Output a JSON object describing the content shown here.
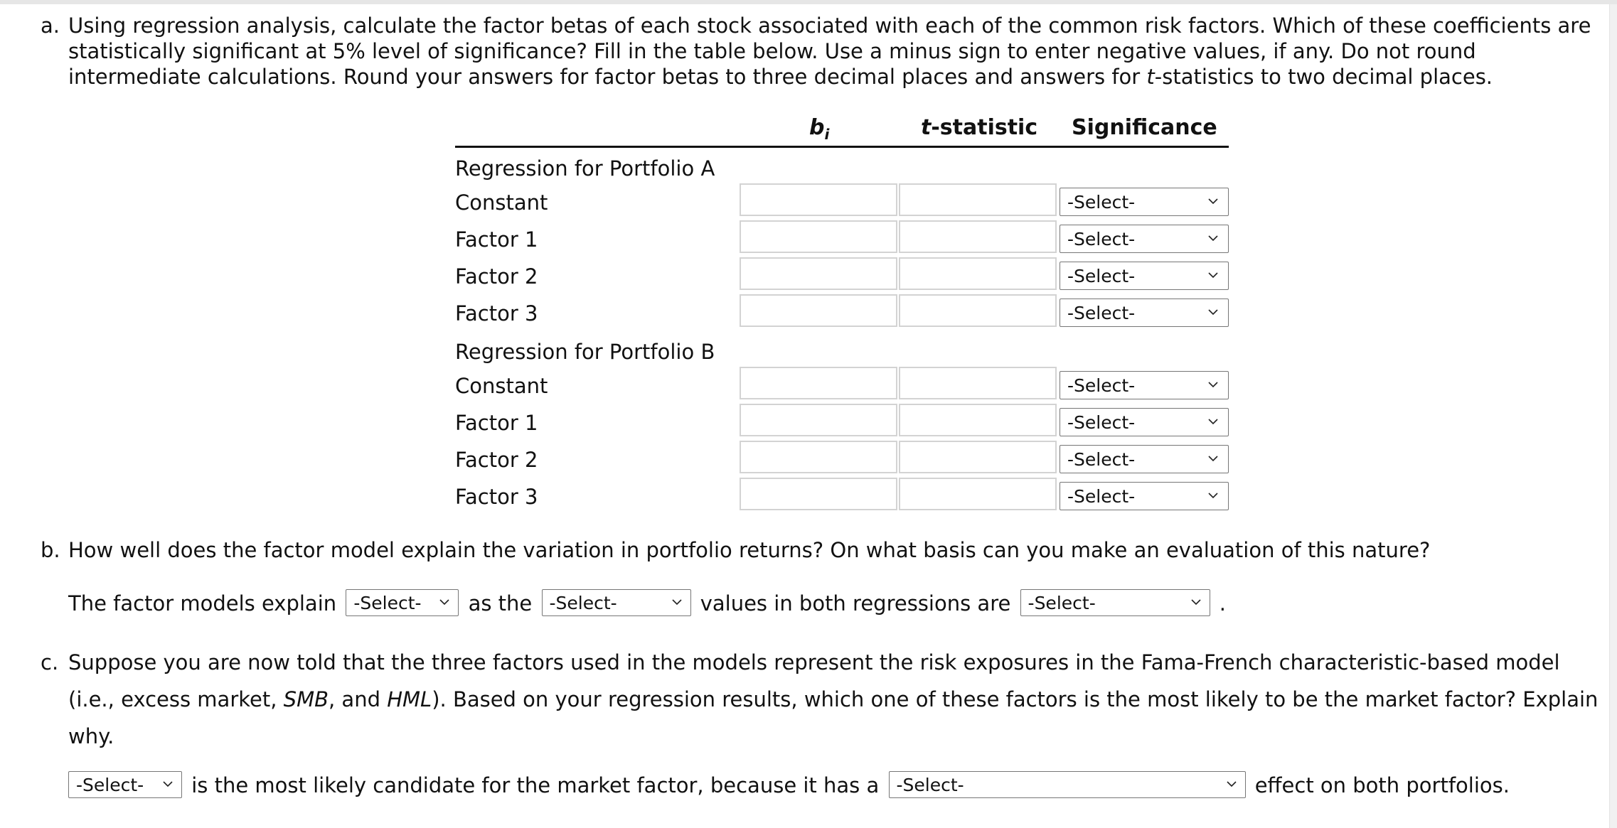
{
  "part_a": {
    "lead": "a.",
    "text_1": "Using regression analysis, calculate the factor betas of each stock associated with each of the common risk factors. Which of these coefficients are statistically significant at 5% level of significance? Fill in the table below. Use a minus sign to enter negative values, if any. Do not round intermediate calculations. Round your answers for factor betas to three decimal places and answers for ",
    "text_t": "t",
    "text_2": "-statistics to two decimal places.",
    "table": {
      "headers": {
        "bi_base": "b",
        "bi_sub": "i",
        "t_italic": "t",
        "t_rest": "-statistic",
        "significance": "Significance"
      },
      "groups": [
        {
          "label": "Regression for Portfolio A",
          "rows": [
            {
              "label": "Constant",
              "bi_value": "",
              "t_value": "",
              "significance": "-Select-"
            },
            {
              "label": "Factor 1",
              "bi_value": "",
              "t_value": "",
              "significance": "-Select-"
            },
            {
              "label": "Factor 2",
              "bi_value": "",
              "t_value": "",
              "significance": "-Select-"
            },
            {
              "label": "Factor 3",
              "bi_value": "",
              "t_value": "",
              "significance": "-Select-"
            }
          ]
        },
        {
          "label": "Regression for Portfolio B",
          "rows": [
            {
              "label": "Constant",
              "bi_value": "",
              "t_value": "",
              "significance": "-Select-"
            },
            {
              "label": "Factor 1",
              "bi_value": "",
              "t_value": "",
              "significance": "-Select-"
            },
            {
              "label": "Factor 2",
              "bi_value": "",
              "t_value": "",
              "significance": "-Select-"
            },
            {
              "label": "Factor 3",
              "bi_value": "",
              "t_value": "",
              "significance": "-Select-"
            }
          ]
        }
      ]
    }
  },
  "part_b": {
    "lead": "b.",
    "question": "How well does the factor model explain the variation in portfolio returns? On what basis can you make an evaluation of this nature?",
    "fill": {
      "text_1": "The factor models explain",
      "select_1": "-Select-",
      "text_2": "as the",
      "select_2": "-Select-",
      "text_3": "values in both regressions are",
      "select_3": "-Select-",
      "text_4": "."
    }
  },
  "part_c": {
    "lead": "c.",
    "q_1": "Suppose you are now told that the three factors used in the models represent the risk exposures in the Fama-French characteristic-based model (i.e., excess market, ",
    "q_smb": "SMB",
    "q_2": ", and ",
    "q_hml": "HML",
    "q_3": "). Based on your regression results, which one of these factors is the most likely to be the market factor? Explain why.",
    "fill": {
      "select_1": "-Select-",
      "text_1": "is the most likely candidate for the market factor, because it has a",
      "select_2": "-Select-",
      "text_2": "effect on both portfolios."
    }
  },
  "icons": {
    "dropdown": "chevron-down-icon"
  }
}
